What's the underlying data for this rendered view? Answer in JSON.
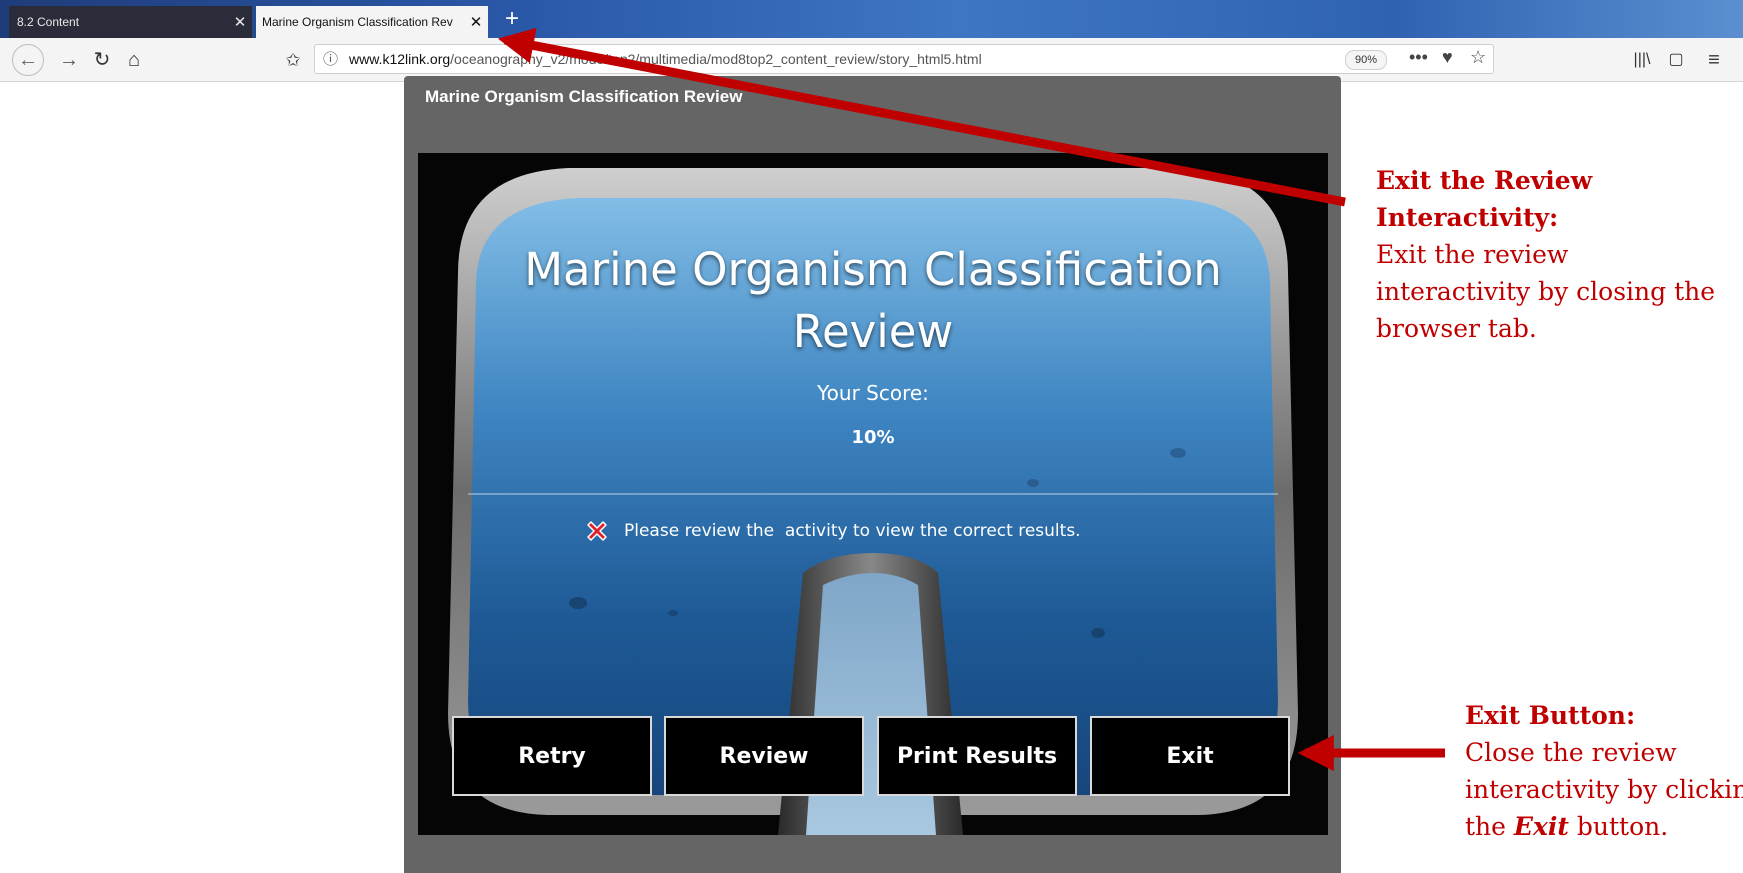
{
  "browser": {
    "tabs": [
      {
        "label": "8.2 Content",
        "active": false
      },
      {
        "label": "Marine Organism Classification Rev",
        "active": true
      }
    ],
    "new_tab_symbol": "+",
    "url": {
      "domain": "www.k12link.org",
      "path": "/oceanography_v2/mod8/top2/multimedia/mod8top2_content_review/story_html5.html"
    },
    "zoom": "90%",
    "icons": [
      "back-icon",
      "forward-icon",
      "reload-icon",
      "home-icon",
      "bookmark-star-icon",
      "info-icon",
      "more-icon",
      "pocket-icon",
      "star-icon",
      "library-icon",
      "sidebar-icon",
      "menu-icon"
    ]
  },
  "player": {
    "title": "Marine Organism Classification Review"
  },
  "slide": {
    "title": "Marine Organism Classification Review",
    "score_label": "Your Score:",
    "score_value": "10%",
    "message": "Please review the  activity to view the correct results.",
    "buttons": {
      "retry": "Retry",
      "review": "Review",
      "print": "Print Results",
      "exit": "Exit"
    }
  },
  "annotations": {
    "tab_callout": {
      "heading": "Exit the Review Interactivity:",
      "body": "Exit the review interactivity by closing the browser tab."
    },
    "exit_callout": {
      "heading": "Exit Button:",
      "body_pre": "Close the review interactivity by clicking",
      "body_mid_pre": "the",
      "body_emph": "Exit",
      "body_post": "button."
    },
    "arrow_color": "#c00000"
  }
}
